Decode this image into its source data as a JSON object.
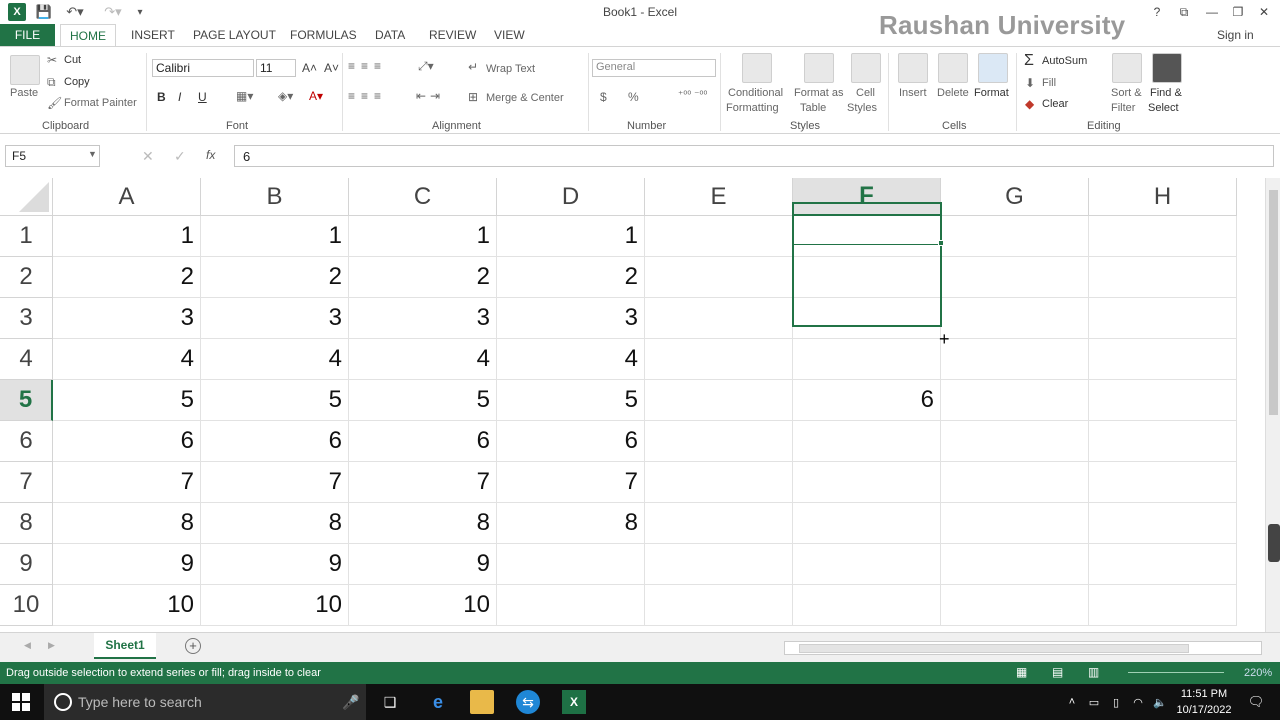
{
  "window": {
    "title": "Book1 - Excel",
    "watermark": "Raushan University",
    "signin": "Sign in"
  },
  "tabs": [
    "FILE",
    "HOME",
    "INSERT",
    "PAGE LAYOUT",
    "FORMULAS",
    "DATA",
    "REVIEW",
    "VIEW"
  ],
  "ribbon": {
    "clipboard": {
      "label": "Clipboard",
      "paste": "Paste",
      "cut": "Cut",
      "copy": "Copy",
      "format_painter": "Format Painter"
    },
    "font": {
      "label": "Font",
      "family": "Calibri",
      "size": "11",
      "bold": "B",
      "italic": "I",
      "underline": "U"
    },
    "alignment": {
      "label": "Alignment",
      "wrap": "Wrap Text",
      "merge": "Merge & Center"
    },
    "number": {
      "label": "Number",
      "format": "General",
      "currency": "$",
      "percent": "%"
    },
    "styles": {
      "label": "Styles",
      "conditional": [
        "Conditional",
        "Formatting"
      ],
      "format_table": [
        "Format as",
        "Table"
      ],
      "cell_styles": [
        "Cell",
        "Styles"
      ]
    },
    "cells": {
      "label": "Cells",
      "insert": "Insert",
      "delete": "Delete",
      "format": "Format"
    },
    "editing": {
      "label": "Editing",
      "autosum": "AutoSum",
      "fill": "Fill",
      "clear": "Clear",
      "sort": [
        "Sort &",
        "Filter"
      ],
      "find": [
        "Find &",
        "Select"
      ]
    }
  },
  "formula_bar": {
    "name_box": "F5",
    "fx": "fx",
    "value": "6"
  },
  "columns": [
    "A",
    "B",
    "C",
    "D",
    "E",
    "F",
    "G",
    "H"
  ],
  "rows": [
    "1",
    "2",
    "3",
    "4",
    "5",
    "6",
    "7",
    "8",
    "9",
    "10"
  ],
  "cells": {
    "A": [
      "1",
      "2",
      "3",
      "4",
      "5",
      "6",
      "7",
      "8",
      "9",
      "10"
    ],
    "B": [
      "1",
      "2",
      "3",
      "4",
      "5",
      "6",
      "7",
      "8",
      "9",
      "10"
    ],
    "C": [
      "1",
      "2",
      "3",
      "4",
      "5",
      "6",
      "7",
      "8",
      "9",
      "10"
    ],
    "D": [
      "1",
      "2",
      "3",
      "4",
      "5",
      "6",
      "7",
      "8",
      "",
      ""
    ],
    "F5": "6"
  },
  "sheet": {
    "tab": "Sheet1",
    "add": "+"
  },
  "status": {
    "message": "Drag outside selection to extend series or fill; drag inside to clear",
    "zoom": "220%"
  },
  "taskbar": {
    "search_placeholder": "Type here to search",
    "time": "11:51 PM",
    "date": "10/17/2022"
  },
  "colors": {
    "accent": "#217346"
  }
}
